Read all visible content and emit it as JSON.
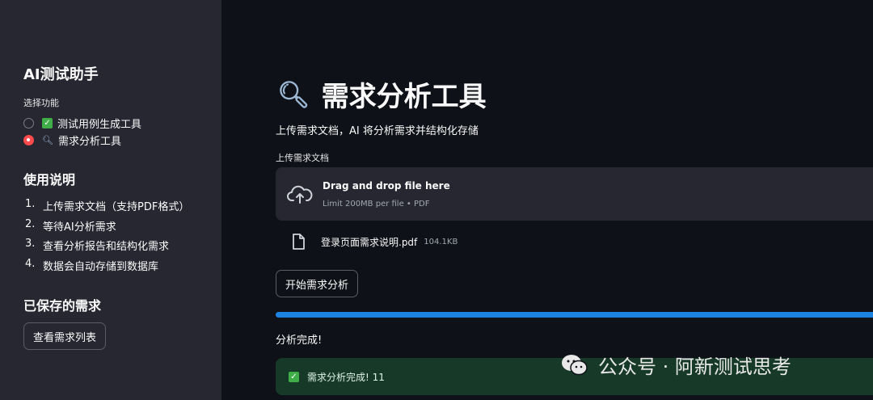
{
  "sidebar": {
    "title": "AI测试助手",
    "choose_label": "选择功能",
    "options": [
      {
        "icon": "check-mark-icon",
        "label": "测试用例生成工具",
        "selected": false
      },
      {
        "icon": "magnifier-icon",
        "label": "需求分析工具",
        "selected": true
      }
    ],
    "usage_heading": "使用说明",
    "steps": [
      {
        "num": "1.",
        "text": "上传需求文档（支持PDF格式）"
      },
      {
        "num": "2.",
        "text": "等待AI分析需求"
      },
      {
        "num": "3.",
        "text": "查看分析报告和结构化需求"
      },
      {
        "num": "4.",
        "text": "数据会自动存储到数据库"
      }
    ],
    "saved_heading": "已保存的需求",
    "view_list_button": "查看需求列表"
  },
  "main": {
    "title_icon": "magnifier-icon",
    "title": "需求分析工具",
    "description": "上传需求文档，AI 将分析需求并结构化存储",
    "upload_label": "上传需求文档",
    "dropzone": {
      "icon": "cloud-upload-icon",
      "main_text": "Drag and drop file here",
      "sub_text": "Limit 200MB per file • PDF"
    },
    "file": {
      "icon": "file-icon",
      "name": "登录页面需求说明.pdf",
      "size": "104.1KB"
    },
    "start_button": "开始需求分析",
    "progress": 1.0,
    "done_text": "分析完成!",
    "success_message": "需求分析完成! 11",
    "colors": {
      "accent_red": "#ff4b4b",
      "progress_blue": "#1c83e1",
      "success_bg": "#173928"
    }
  },
  "watermark": {
    "icon": "wechat-icon",
    "text": "公众号 · 阿新测试思考"
  }
}
